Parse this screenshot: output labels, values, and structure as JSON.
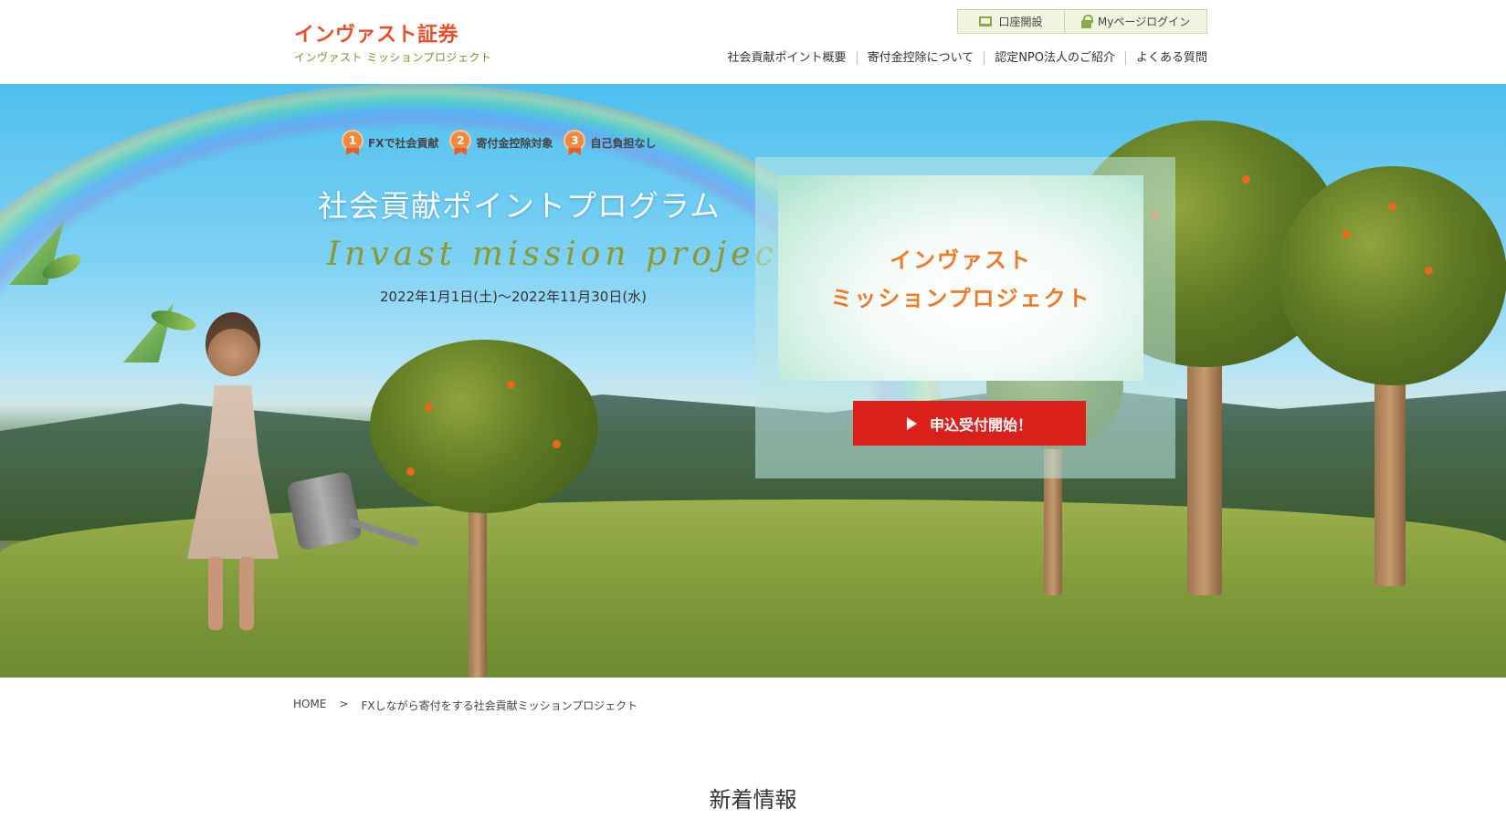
{
  "header": {
    "logo_main": "インヴァスト証券",
    "logo_sub": "インヴァスト ミッションプロジェクト",
    "account_button": "口座開設",
    "login_button": "Myページログイン",
    "nav": [
      {
        "label": "社会貢献ポイント概要"
      },
      {
        "label": "寄付金控除について"
      },
      {
        "label": "認定NPO法人のご紹介"
      },
      {
        "label": "よくある質問"
      }
    ]
  },
  "hero": {
    "badges": [
      {
        "number": "1",
        "label": "FXで社会貢献"
      },
      {
        "number": "2",
        "label": "寄付金控除対象"
      },
      {
        "number": "3",
        "label": "自己負担なし"
      }
    ],
    "title": "社会貢献ポイントプログラム",
    "title_en": "Invast mission project",
    "date": "2022年1月1日(土)～2022年11月30日(水)",
    "card_line1": "インヴァスト",
    "card_line2": "ミッションプロジェクト",
    "apply_button": "申込受付開始！"
  },
  "breadcrumb": {
    "home": "HOME",
    "separator": ">",
    "current": "FXしながら寄付をする社会貢献ミッションプロジェクト"
  },
  "news": {
    "title": "新着情報"
  },
  "colors": {
    "brand_orange": "#e8502a",
    "accent_green": "#8aa84a",
    "apply_red": "#d9201b"
  }
}
